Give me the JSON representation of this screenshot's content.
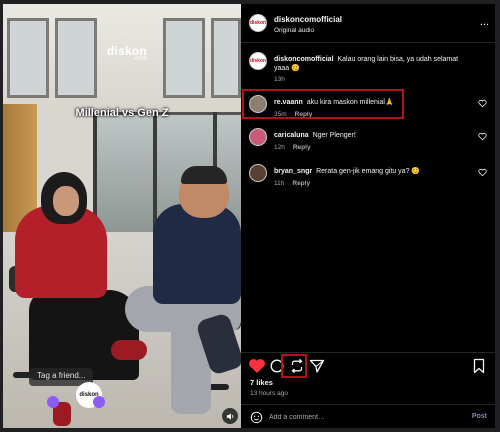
{
  "video": {
    "brand_mark": "diskon",
    "brand_mark_sub": ".com",
    "overlay_title": "Millenial vs Gen Z",
    "tag_chip": "Tag a friend...",
    "mini_avatar_text": "diskon"
  },
  "header": {
    "avatar_text": "diskon",
    "username": "diskoncomofficial",
    "audio": "Original audio",
    "more_label": "..."
  },
  "caption": {
    "avatar_text": "diskon",
    "username": "diskoncomofficial",
    "text": "Kalau orang lain bisa, ya udah selamat yaaa 😊",
    "time": "13h"
  },
  "comments": [
    {
      "username": "re.vaann",
      "text": "aku kira maskon millenial🙏",
      "time": "35m",
      "reply": "Reply",
      "highlighted": true
    },
    {
      "username": "caricaluna",
      "text": "Nger Plenger!",
      "time": "12h",
      "reply": "Reply",
      "highlighted": false
    },
    {
      "username": "bryan_sngr",
      "text": "Rerata gen-jik emang gitu ya? 😊",
      "time": "11h",
      "reply": "Reply",
      "highlighted": false
    }
  ],
  "actions": {
    "like_icon": "heart-filled-icon",
    "comment_icon": "comment-icon",
    "repost_icon": "repost-icon",
    "share_icon": "send-icon",
    "save_icon": "bookmark-icon",
    "liked_color": "#ff3040",
    "highlight_color": "#b3121b"
  },
  "stats": {
    "likes": "7 likes",
    "posted": "13 hours ago"
  },
  "composer": {
    "placeholder": "Add a comment…",
    "post_label": "Post"
  }
}
